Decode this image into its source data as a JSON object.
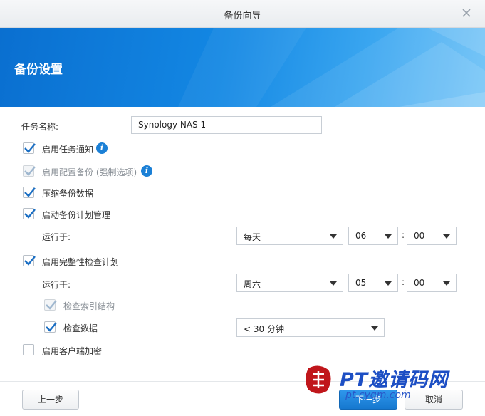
{
  "window": {
    "title": "备份向导"
  },
  "banner": {
    "heading": "备份设置"
  },
  "task_name": {
    "label": "任务名称:",
    "value": "Synology NAS 1"
  },
  "options": {
    "enable_task_notification": {
      "label": "启用任务通知",
      "checked": true
    },
    "enable_config_backup": {
      "label": "启用配置备份 (强制选项)",
      "checked": true,
      "disabled": true
    },
    "compress_backup_data": {
      "label": "压缩备份数据",
      "checked": true
    },
    "enable_backup_schedule": {
      "label": "启动备份计划管理",
      "checked": true
    },
    "enable_integrity_check": {
      "label": "启用完整性检查计划",
      "checked": true
    },
    "check_index_structure": {
      "label": "检查索引结构",
      "checked": true,
      "disabled": true
    },
    "check_data": {
      "label": "检查数据",
      "checked": true
    },
    "enable_client_encryption": {
      "label": "启用客户端加密",
      "checked": false
    }
  },
  "backup_schedule": {
    "run_label": "运行于:",
    "day": "每天",
    "hour": "06",
    "minute": "00",
    "separator": ":"
  },
  "integrity_schedule": {
    "run_label": "运行于:",
    "day": "周六",
    "hour": "05",
    "minute": "00",
    "separator": ":"
  },
  "check_data_duration": "< 30 分钟",
  "footer": {
    "prev_label": "上一步",
    "next_label": "下一步",
    "cancel_label": "取消"
  },
  "watermark": {
    "text": "PT邀请码网",
    "url": "pt.cyqm.com"
  }
}
